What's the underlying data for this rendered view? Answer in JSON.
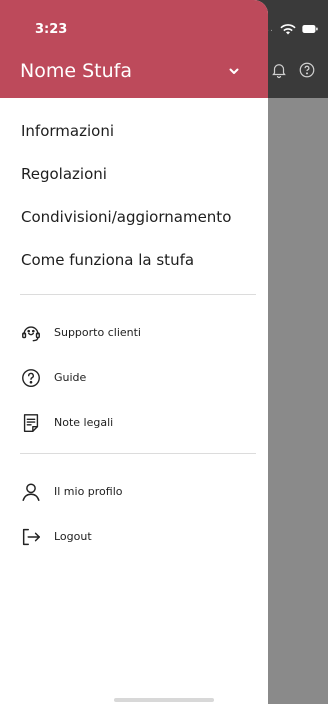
{
  "status_bar": {
    "time": "3:23",
    "signal_dots": "...."
  },
  "drawer": {
    "header": {
      "title": "Nome Stufa",
      "chevron_icon": "chevron-down-icon"
    },
    "primary_items": [
      {
        "label": "Informazioni"
      },
      {
        "label": "Regolazioni"
      },
      {
        "label": "Condivisioni/aggiornamento"
      },
      {
        "label": "Come funziona la stufa"
      }
    ],
    "support_items": [
      {
        "label": "Supporto clienti",
        "icon": "headset-icon"
      },
      {
        "label": "Guide",
        "icon": "help-circle-icon"
      },
      {
        "label": "Note legali",
        "icon": "document-icon"
      }
    ],
    "account_items": [
      {
        "label": "Il mio profilo",
        "icon": "user-icon"
      },
      {
        "label": "Logout",
        "icon": "logout-icon"
      }
    ]
  },
  "background_app": {
    "icons": [
      "bell-icon",
      "help-circle-icon"
    ]
  },
  "colors": {
    "header_red": "#bd4a5b",
    "backdrop_gray": "#8a8a8a",
    "topbar_dark": "#3a3a3a"
  }
}
